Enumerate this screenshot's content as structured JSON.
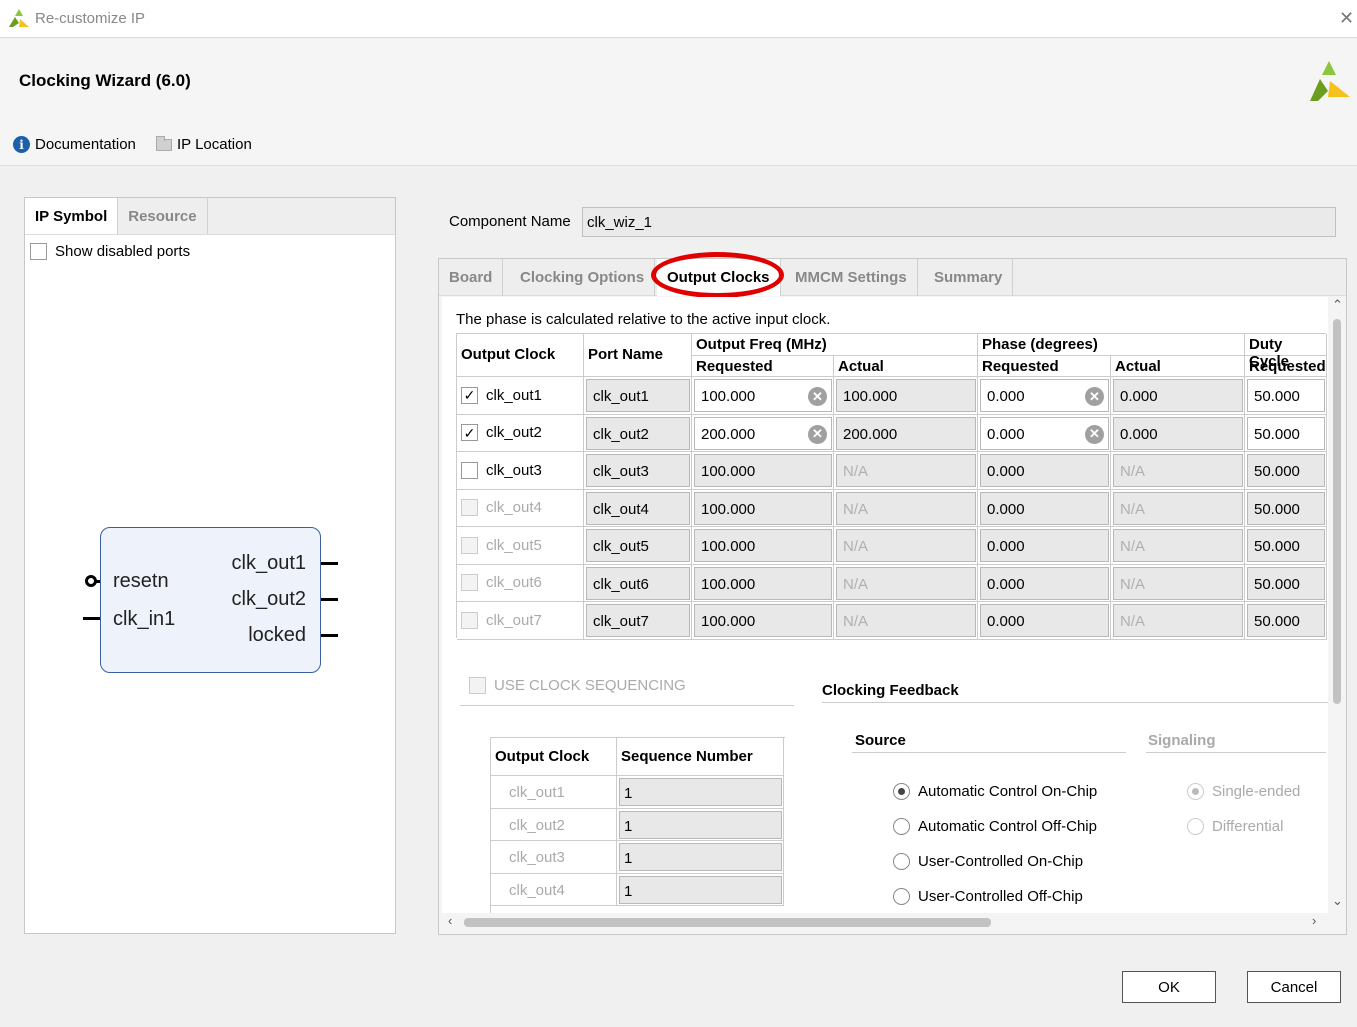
{
  "window": {
    "title": "Re-customize IP",
    "close_glyph": "✕"
  },
  "header": {
    "title": "Clocking Wizard (6.0)",
    "doc_link": "Documentation",
    "ip_location_link": "IP Location"
  },
  "left_panel": {
    "tabs": [
      "IP Symbol",
      "Resource"
    ],
    "show_disabled_ports": "Show disabled ports",
    "symbol": {
      "left_ports": [
        "resetn",
        "clk_in1"
      ],
      "right_ports": [
        "clk_out1",
        "clk_out2",
        "locked"
      ]
    }
  },
  "component": {
    "label": "Component Name",
    "value": "clk_wiz_1"
  },
  "tabs": [
    "Board",
    "Clocking Options",
    "Output Clocks",
    "MMCM Settings",
    "Summary"
  ],
  "phase_note": "The phase is calculated relative to the active input clock.",
  "table": {
    "headers": {
      "output_clock": "Output Clock",
      "port_name": "Port Name",
      "freq_group": "Output Freq (MHz)",
      "phase_group": "Phase (degrees)",
      "duty_group": "Duty Cycle",
      "requested": "Requested",
      "actual": "Actual"
    },
    "rows": [
      {
        "clock": "clk_out1",
        "checked": true,
        "port": "clk_out1",
        "freq_req": "100.000",
        "freq_act": "100.000",
        "phase_req": "0.000",
        "phase_act": "0.000",
        "duty": "50.000"
      },
      {
        "clock": "clk_out2",
        "checked": true,
        "port": "clk_out2",
        "freq_req": "200.000",
        "freq_act": "200.000",
        "phase_req": "0.000",
        "phase_act": "0.000",
        "duty": "50.000"
      },
      {
        "clock": "clk_out3",
        "checked": false,
        "port": "clk_out3",
        "freq_req": "100.000",
        "freq_act": "N/A",
        "phase_req": "0.000",
        "phase_act": "N/A",
        "duty": "50.000"
      },
      {
        "clock": "clk_out4",
        "checked": false,
        "port": "clk_out4",
        "freq_req": "100.000",
        "freq_act": "N/A",
        "phase_req": "0.000",
        "phase_act": "N/A",
        "duty": "50.000"
      },
      {
        "clock": "clk_out5",
        "checked": false,
        "port": "clk_out5",
        "freq_req": "100.000",
        "freq_act": "N/A",
        "phase_req": "0.000",
        "phase_act": "N/A",
        "duty": "50.000"
      },
      {
        "clock": "clk_out6",
        "checked": false,
        "port": "clk_out6",
        "freq_req": "100.000",
        "freq_act": "N/A",
        "phase_req": "0.000",
        "phase_act": "N/A",
        "duty": "50.000"
      },
      {
        "clock": "clk_out7",
        "checked": false,
        "port": "clk_out7",
        "freq_req": "100.000",
        "freq_act": "N/A",
        "phase_req": "0.000",
        "phase_act": "N/A",
        "duty": "50.000"
      }
    ]
  },
  "sequencing": {
    "checkbox_label": "USE CLOCK SEQUENCING",
    "headers": [
      "Output Clock",
      "Sequence Number"
    ],
    "rows": [
      {
        "clock": "clk_out1",
        "seq": "1"
      },
      {
        "clock": "clk_out2",
        "seq": "1"
      },
      {
        "clock": "clk_out3",
        "seq": "1"
      },
      {
        "clock": "clk_out4",
        "seq": "1"
      }
    ]
  },
  "feedback": {
    "title": "Clocking Feedback",
    "source_label": "Source",
    "signaling_label": "Signaling",
    "source_options": [
      "Automatic Control On-Chip",
      "Automatic Control Off-Chip",
      "User-Controlled On-Chip",
      "User-Controlled Off-Chip"
    ],
    "source_selected": "Automatic Control On-Chip",
    "signaling_options": [
      "Single-ended",
      "Differential"
    ],
    "signaling_selected": "Single-ended"
  },
  "buttons": {
    "ok": "OK",
    "cancel": "Cancel"
  },
  "colors": {
    "annotation": "#e00000",
    "symbol_fill": "#eef3fb",
    "info_blue": "#1d5fa8"
  },
  "icons": [
    "xilinx-logo-icon",
    "info-icon",
    "folder-icon",
    "close-icon",
    "clear-icon",
    "check-icon"
  ]
}
